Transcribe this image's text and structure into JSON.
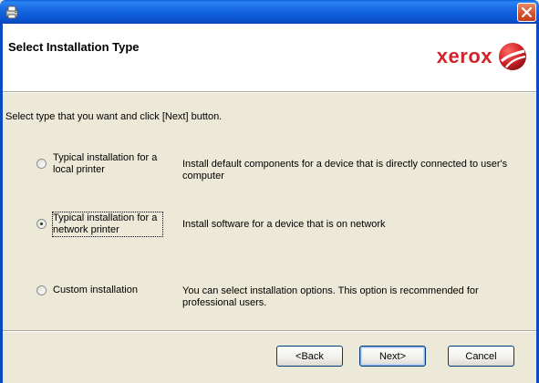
{
  "window": {
    "title": ""
  },
  "header": {
    "title": "Select Installation Type",
    "logo_text": "xerox"
  },
  "instruction": "Select type that you want and click [Next] button.",
  "options": [
    {
      "label": "Typical installation for a local printer",
      "description": "Install default components for a device that is directly connected to user's computer",
      "checked": false
    },
    {
      "label": "Typical installation for a network printer",
      "description": "Install software for a device that is on network",
      "checked": true
    },
    {
      "label": "Custom installation",
      "description": "You can select installation options. This option is recommended for professional users.",
      "checked": false
    }
  ],
  "buttons": {
    "back": "<Back",
    "next": "Next>",
    "cancel": "Cancel"
  },
  "colors": {
    "titlebar": "#0b54d2",
    "logo_red": "#d2232a",
    "dialog_bg": "#ece9d8"
  },
  "icons": {
    "app": "installer-icon",
    "close": "close-icon",
    "logo": "xerox-sphere-logo"
  }
}
